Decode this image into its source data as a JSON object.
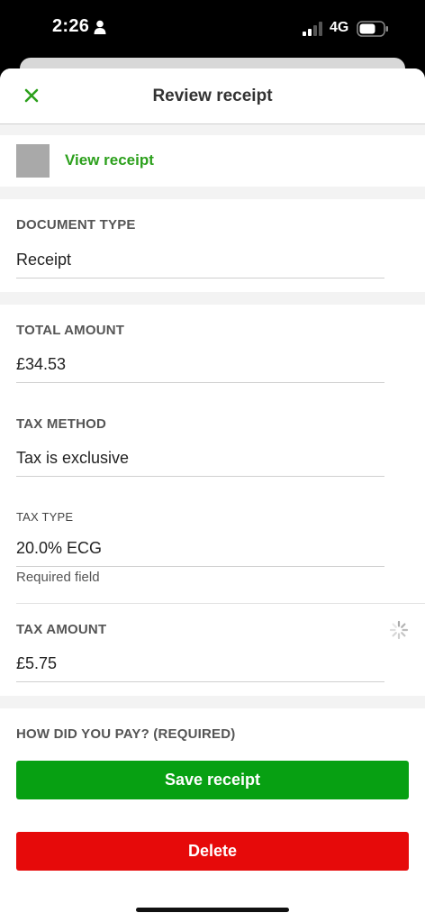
{
  "status_bar": {
    "time": "2:26",
    "network": "4G"
  },
  "header": {
    "title": "Review receipt"
  },
  "receipt": {
    "view_label": "View receipt"
  },
  "document_type": {
    "label": "DOCUMENT TYPE",
    "value": "Receipt"
  },
  "total_amount": {
    "label": "TOTAL AMOUNT",
    "value": "£34.53"
  },
  "tax_method": {
    "label": "TAX METHOD",
    "value": "Tax is exclusive"
  },
  "tax_type": {
    "label": "TAX TYPE",
    "value": "20.0% ECG",
    "helper": "Required field"
  },
  "tax_amount": {
    "label": "TAX AMOUNT",
    "value": "£5.75"
  },
  "payment": {
    "label": "HOW DID YOU PAY? (REQUIRED)"
  },
  "actions": {
    "save_label": "Save receipt",
    "delete_label": "Delete"
  },
  "colors": {
    "accent_green": "#2ca01c",
    "save_button": "#07a012",
    "delete_button": "#e60a0a"
  },
  "icons": {
    "close": "close-icon",
    "person": "person-icon",
    "signal": "signal-icon",
    "battery": "battery-icon",
    "loading": "spinner-icon"
  }
}
